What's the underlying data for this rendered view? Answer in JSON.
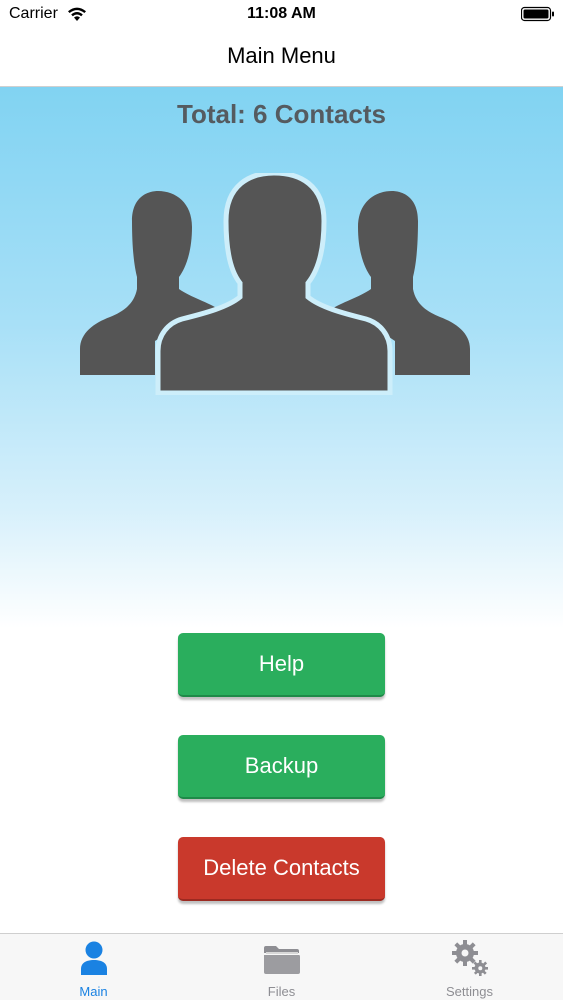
{
  "status_bar": {
    "carrier": "Carrier",
    "time": "11:08 AM"
  },
  "nav": {
    "title": "Main Menu"
  },
  "main": {
    "total_label": "Total: 6 Contacts",
    "buttons": {
      "help": "Help",
      "backup": "Backup",
      "delete": "Delete Contacts"
    }
  },
  "tab_bar": {
    "tabs": [
      {
        "label": "Main",
        "icon": "person-icon",
        "selected": true
      },
      {
        "label": "Files",
        "icon": "folder-icon",
        "selected": false
      },
      {
        "label": "Settings",
        "icon": "gears-icon",
        "selected": false
      }
    ]
  },
  "colors": {
    "accent": "#1a82e2",
    "green_button": "#2aae5d",
    "red_button": "#c9392c",
    "gradient_top": "#81d3f2",
    "silhouette": "#555555"
  }
}
